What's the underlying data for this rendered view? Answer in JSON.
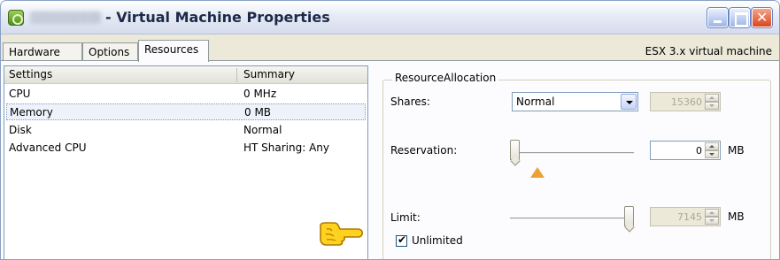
{
  "window": {
    "vm_name": "vmGECS2",
    "title": "- Virtual Machine Properties",
    "controls": {
      "minimize": "minimize",
      "maximize": "maximize",
      "close": "✕"
    }
  },
  "tabs": [
    {
      "label": "Hardware",
      "active": false
    },
    {
      "label": "Options",
      "active": false
    },
    {
      "label": "Resources",
      "active": true
    }
  ],
  "vm_type": "ESX 3.x virtual machine",
  "list": {
    "headers": {
      "settings": "Settings",
      "summary": "Summary"
    },
    "rows": [
      {
        "setting": "CPU",
        "summary": "0 MHz",
        "selected": false
      },
      {
        "setting": "Memory",
        "summary": "0 MB",
        "selected": true
      },
      {
        "setting": "Disk",
        "summary": "Normal",
        "selected": false
      },
      {
        "setting": "Advanced CPU",
        "summary": "HT Sharing: Any",
        "selected": false
      }
    ]
  },
  "resource_allocation": {
    "title": "ResourceAllocation",
    "shares": {
      "label": "Shares:",
      "selected": "Normal",
      "value": "15360",
      "value_enabled": false
    },
    "reservation": {
      "label": "Reservation:",
      "value": "0",
      "unit": "MB",
      "slider_fraction": 0.0
    },
    "limit": {
      "label": "Limit:",
      "value": "7145",
      "unit": "MB",
      "slider_fraction": 1.0,
      "value_enabled": false
    },
    "unlimited": {
      "label": "Unlimited",
      "checked": true
    }
  },
  "icons": {
    "app": "vm-icon",
    "pointer": "pointing-hand-icon",
    "warning": "warning-triangle-icon"
  },
  "colors": {
    "selection_border": "#7f9db9",
    "warning": "#f0a030",
    "close_button": "#d8461c"
  }
}
